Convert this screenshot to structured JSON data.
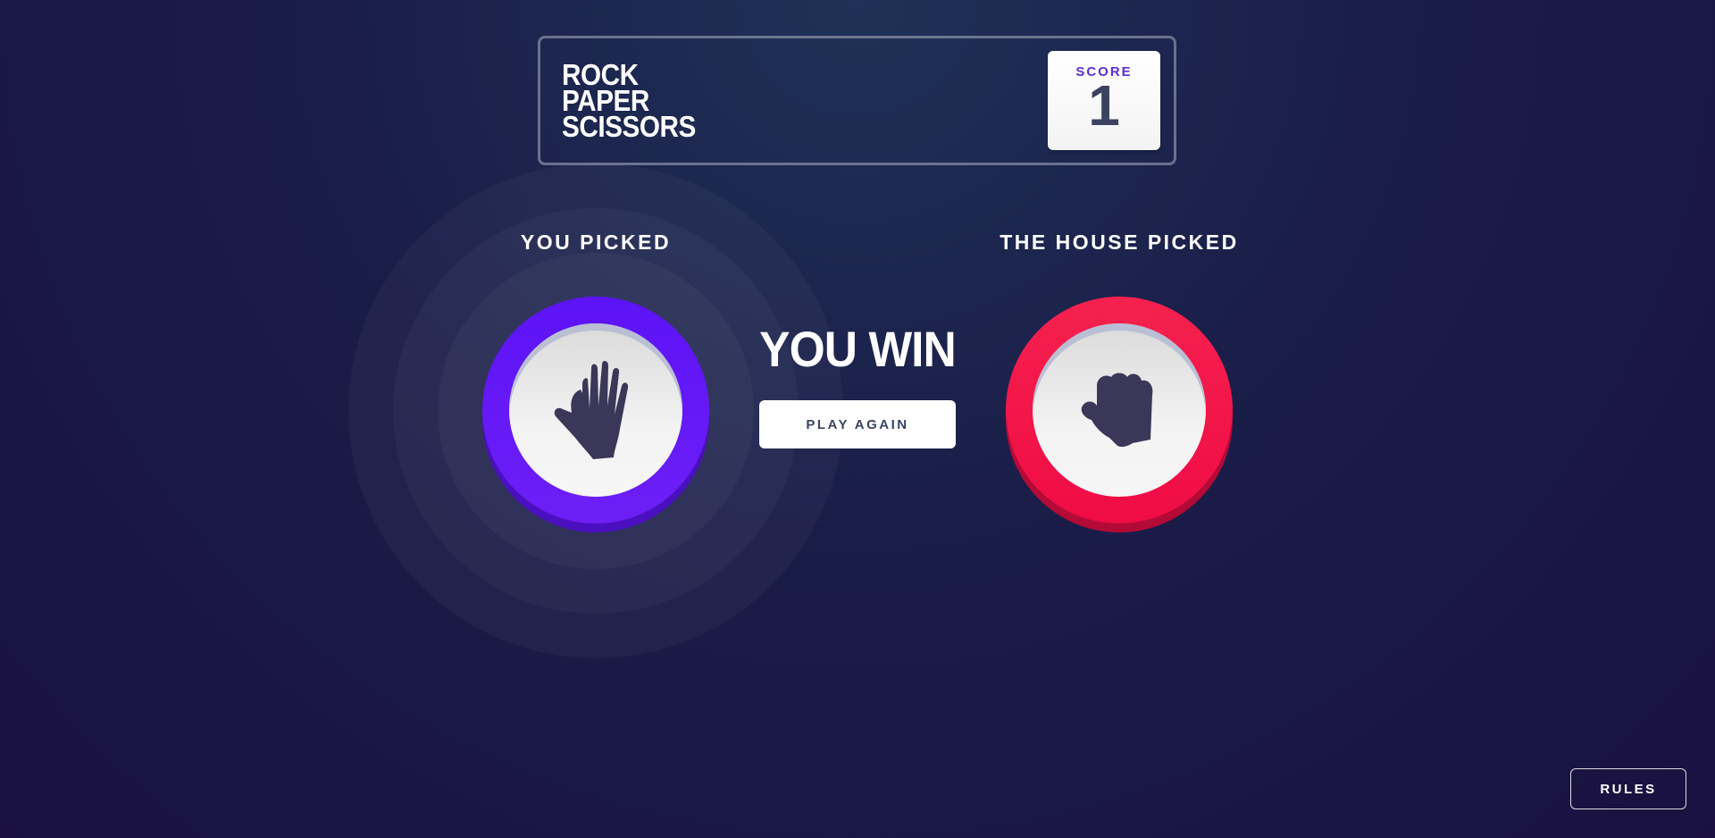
{
  "header": {
    "title_lines": [
      "ROCK",
      "PAPER",
      "SCISSORS"
    ],
    "score_label": "SCORE",
    "score_value": "1"
  },
  "game": {
    "player_label": "YOU PICKED",
    "house_label": "THE HOUSE PICKED",
    "player_pick": "paper",
    "house_pick": "rock",
    "result_text": "YOU WIN",
    "play_again_label": "PLAY AGAIN"
  },
  "footer": {
    "rules_label": "RULES"
  },
  "icons": {
    "player": "paper-hand-icon",
    "house": "rock-fist-icon"
  },
  "colors": {
    "paper": "#5c13f6",
    "rock": "#f5214e",
    "score_label": "#5b2ed4",
    "dark_text": "#3b4262"
  }
}
